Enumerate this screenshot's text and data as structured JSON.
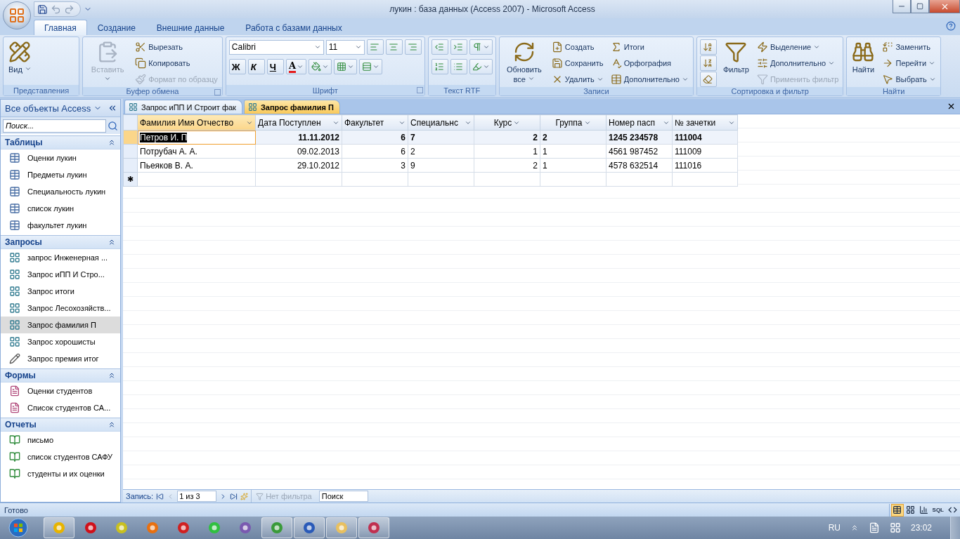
{
  "window": {
    "title": "лукин : база данных (Access 2007)  -  Microsoft Access"
  },
  "ribbon_tabs": [
    {
      "label": "Главная",
      "selected": true
    },
    {
      "label": "Создание",
      "selected": false
    },
    {
      "label": "Внешние данные",
      "selected": false
    },
    {
      "label": "Работа с базами данных",
      "selected": false
    }
  ],
  "ribbon": {
    "groups": [
      {
        "title": "Представления",
        "launcher": false,
        "columns": [
          [
            {
              "kind": "large",
              "label": "Вид",
              "dropdown": true,
              "disabled": false
            }
          ]
        ]
      },
      {
        "title": "Буфер обмена",
        "launcher": true,
        "columns": [
          [
            {
              "kind": "large",
              "label": "Вставить",
              "dropdown": true,
              "disabled": true
            }
          ],
          [
            {
              "kind": "small",
              "label": "Вырезать",
              "dropdown": false,
              "disabled": false
            },
            {
              "kind": "small",
              "label": "Копировать",
              "dropdown": false,
              "disabled": false
            },
            {
              "kind": "small",
              "label": "Формат по образцу",
              "dropdown": false,
              "disabled": true
            }
          ]
        ]
      },
      {
        "title": "Шрифт",
        "launcher": true,
        "columns": [
          [
            {
              "kind": "row",
              "items": [
                {
                  "kind": "combo",
                  "value": "Calibri"
                },
                {
                  "kind": "combo",
                  "value": "11"
                },
                {
                  "kind": "icon",
                  "dropdown": false
                },
                {
                  "kind": "icon",
                  "dropdown": false
                },
                {
                  "kind": "icon",
                  "dropdown": false
                }
              ]
            },
            {
              "kind": "row",
              "items": [
                {
                  "kind": "text",
                  "label": "Ж",
                  "dropdown": false
                },
                {
                  "kind": "text",
                  "label": "К",
                  "dropdown": false
                },
                {
                  "kind": "text",
                  "label": "Ч",
                  "dropdown": false
                },
                {
                  "kind": "text",
                  "label": "А",
                  "dropdown": true
                },
                {
                  "kind": "icon",
                  "dropdown": true
                },
                {
                  "kind": "icon",
                  "dropdown": true
                },
                {
                  "kind": "icon",
                  "dropdown": true
                }
              ]
            }
          ]
        ]
      },
      {
        "title": "Текст RTF",
        "launcher": false,
        "columns": [
          [
            {
              "kind": "row",
              "items": [
                {
                  "kind": "icon",
                  "dropdown": false
                },
                {
                  "kind": "icon",
                  "dropdown": false
                },
                {
                  "kind": "icon",
                  "dropdown": true
                }
              ]
            },
            {
              "kind": "row",
              "items": [
                {
                  "kind": "icon",
                  "dropdown": false
                },
                {
                  "kind": "icon",
                  "dropdown": false
                },
                {
                  "kind": "icon",
                  "dropdown": true
                }
              ]
            }
          ]
        ]
      },
      {
        "title": "Записи",
        "launcher": false,
        "columns": [
          [
            {
              "kind": "large",
              "label": "Обновить все",
              "dropdown": true,
              "disabled": false
            }
          ],
          [
            {
              "kind": "small",
              "label": "Создать",
              "dropdown": false,
              "disabled": false
            },
            {
              "kind": "small",
              "label": "Сохранить",
              "dropdown": false,
              "disabled": false
            },
            {
              "kind": "small",
              "label": "Удалить",
              "dropdown": true,
              "disabled": false
            }
          ],
          [
            {
              "kind": "small",
              "label": "Итоги",
              "dropdown": false,
              "disabled": false
            },
            {
              "kind": "small",
              "label": "Орфография",
              "dropdown": false,
              "disabled": false
            },
            {
              "kind": "small",
              "label": "Дополнительно",
              "dropdown": true,
              "disabled": false
            }
          ]
        ]
      },
      {
        "title": "Сортировка и фильтр",
        "launcher": false,
        "columns": [
          [
            {
              "kind": "icon",
              "dropdown": false
            },
            {
              "kind": "icon",
              "dropdown": false
            },
            {
              "kind": "icon",
              "dropdown": false
            }
          ],
          [
            {
              "kind": "large",
              "label": "Фильтр",
              "dropdown": false,
              "disabled": false
            }
          ],
          [
            {
              "kind": "small",
              "label": "Выделение",
              "dropdown": true,
              "disabled": false
            },
            {
              "kind": "small",
              "label": "Дополнительно",
              "dropdown": true,
              "disabled": false
            },
            {
              "kind": "small",
              "label": "Применить фильтр",
              "dropdown": false,
              "disabled": true
            }
          ]
        ]
      },
      {
        "title": "Найти",
        "launcher": false,
        "columns": [
          [
            {
              "kind": "large",
              "label": "Найти",
              "dropdown": false,
              "disabled": false
            }
          ],
          [
            {
              "kind": "small",
              "label": "Заменить",
              "dropdown": false,
              "disabled": false
            },
            {
              "kind": "small",
              "label": "Перейти",
              "dropdown": true,
              "disabled": false
            },
            {
              "kind": "small",
              "label": "Выбрать",
              "dropdown": true,
              "disabled": false
            }
          ]
        ]
      }
    ]
  },
  "nav": {
    "title": "Все объекты Access",
    "search_placeholder": "Поиск...",
    "sections": [
      {
        "title": "Таблицы",
        "expanded": true,
        "items": [
          {
            "kind": "table",
            "label": "Оценки лукин",
            "selected": false
          },
          {
            "kind": "table",
            "label": "Предметы лукин",
            "selected": false
          },
          {
            "kind": "table",
            "label": "Специальность лукин",
            "selected": false
          },
          {
            "kind": "table",
            "label": "список лукин",
            "selected": false
          },
          {
            "kind": "table",
            "label": "факультет лукин",
            "selected": false
          }
        ]
      },
      {
        "title": "Запросы",
        "expanded": true,
        "items": [
          {
            "kind": "query",
            "label": "запрос Инженерная ...",
            "selected": false
          },
          {
            "kind": "query",
            "label": "Запрос иПП  И Стро...",
            "selected": false
          },
          {
            "kind": "query",
            "label": "Запрос итоги",
            "selected": false
          },
          {
            "kind": "query",
            "label": "Запрос Лесохозяйств...",
            "selected": false
          },
          {
            "kind": "query",
            "label": "Запрос фамилия П",
            "selected": true
          },
          {
            "kind": "query",
            "label": "Запрос хорошисты",
            "selected": false
          },
          {
            "kind": "action",
            "label": "Запрос премия итог",
            "selected": false
          }
        ]
      },
      {
        "title": "Формы",
        "expanded": true,
        "items": [
          {
            "kind": "form",
            "label": "Оценки студентов",
            "selected": false
          },
          {
            "kind": "form",
            "label": "Список студентов СА...",
            "selected": false
          }
        ]
      },
      {
        "title": "Отчеты",
        "expanded": true,
        "items": [
          {
            "kind": "report",
            "label": "письмо",
            "selected": false
          },
          {
            "kind": "report",
            "label": "список студентов САФУ",
            "selected": false
          },
          {
            "kind": "report",
            "label": "студенты и их оценки",
            "selected": false
          }
        ]
      }
    ]
  },
  "doc_tabs": [
    {
      "label": "Запрос иПП  И Строит  фак",
      "selected": false
    },
    {
      "label": "Запрос фамилия П",
      "selected": true
    }
  ],
  "datasheet": {
    "columns": [
      {
        "label": "Фамилия Имя Отчество",
        "selected": true
      },
      {
        "label": "Дата Поступлен",
        "selected": false
      },
      {
        "label": "Факультет",
        "selected": false
      },
      {
        "label": "Специальнс",
        "selected": false
      },
      {
        "label": "Курс",
        "selected": false
      },
      {
        "label": "Группа",
        "selected": false
      },
      {
        "label": "Номер пасп",
        "selected": false
      },
      {
        "label": "№ зачетки",
        "selected": false
      }
    ],
    "rows": [
      {
        "selected": true,
        "cells": [
          "Петров И. П",
          "11.11.2012",
          "6",
          "7",
          "2",
          "2",
          "1245 234578",
          "111004"
        ]
      },
      {
        "selected": false,
        "cells": [
          "Потрубач А. А.",
          "09.02.2013",
          "6",
          "2",
          "1",
          "1",
          "4561 987452",
          "111009"
        ]
      },
      {
        "selected": false,
        "cells": [
          "Пьеяков В. А.",
          "29.10.2012",
          "3",
          "9",
          "2",
          "1",
          "4578 632514",
          "111016"
        ]
      }
    ],
    "new_row_marker": "✱"
  },
  "record_nav": {
    "label": "Запись:",
    "position": "1 из 3",
    "filter": "Нет фильтра",
    "filter_disabled": true,
    "search_placeholder": "Поиск"
  },
  "status_bar": {
    "text": "Готово",
    "view_buttons": [
      {
        "selected": true
      },
      {
        "selected": false
      },
      {
        "selected": false
      },
      {
        "label": "SQL",
        "selected": false
      },
      {
        "selected": false
      }
    ]
  },
  "taskbar": {
    "apps": [
      {
        "running": true
      },
      {
        "running": false
      },
      {
        "running": false
      },
      {
        "running": false
      },
      {
        "running": false
      },
      {
        "running": false
      },
      {
        "running": false
      },
      {
        "running": true
      },
      {
        "running": true
      },
      {
        "running": true
      },
      {
        "running": true
      }
    ],
    "language": "RU",
    "time": "23:02"
  }
}
